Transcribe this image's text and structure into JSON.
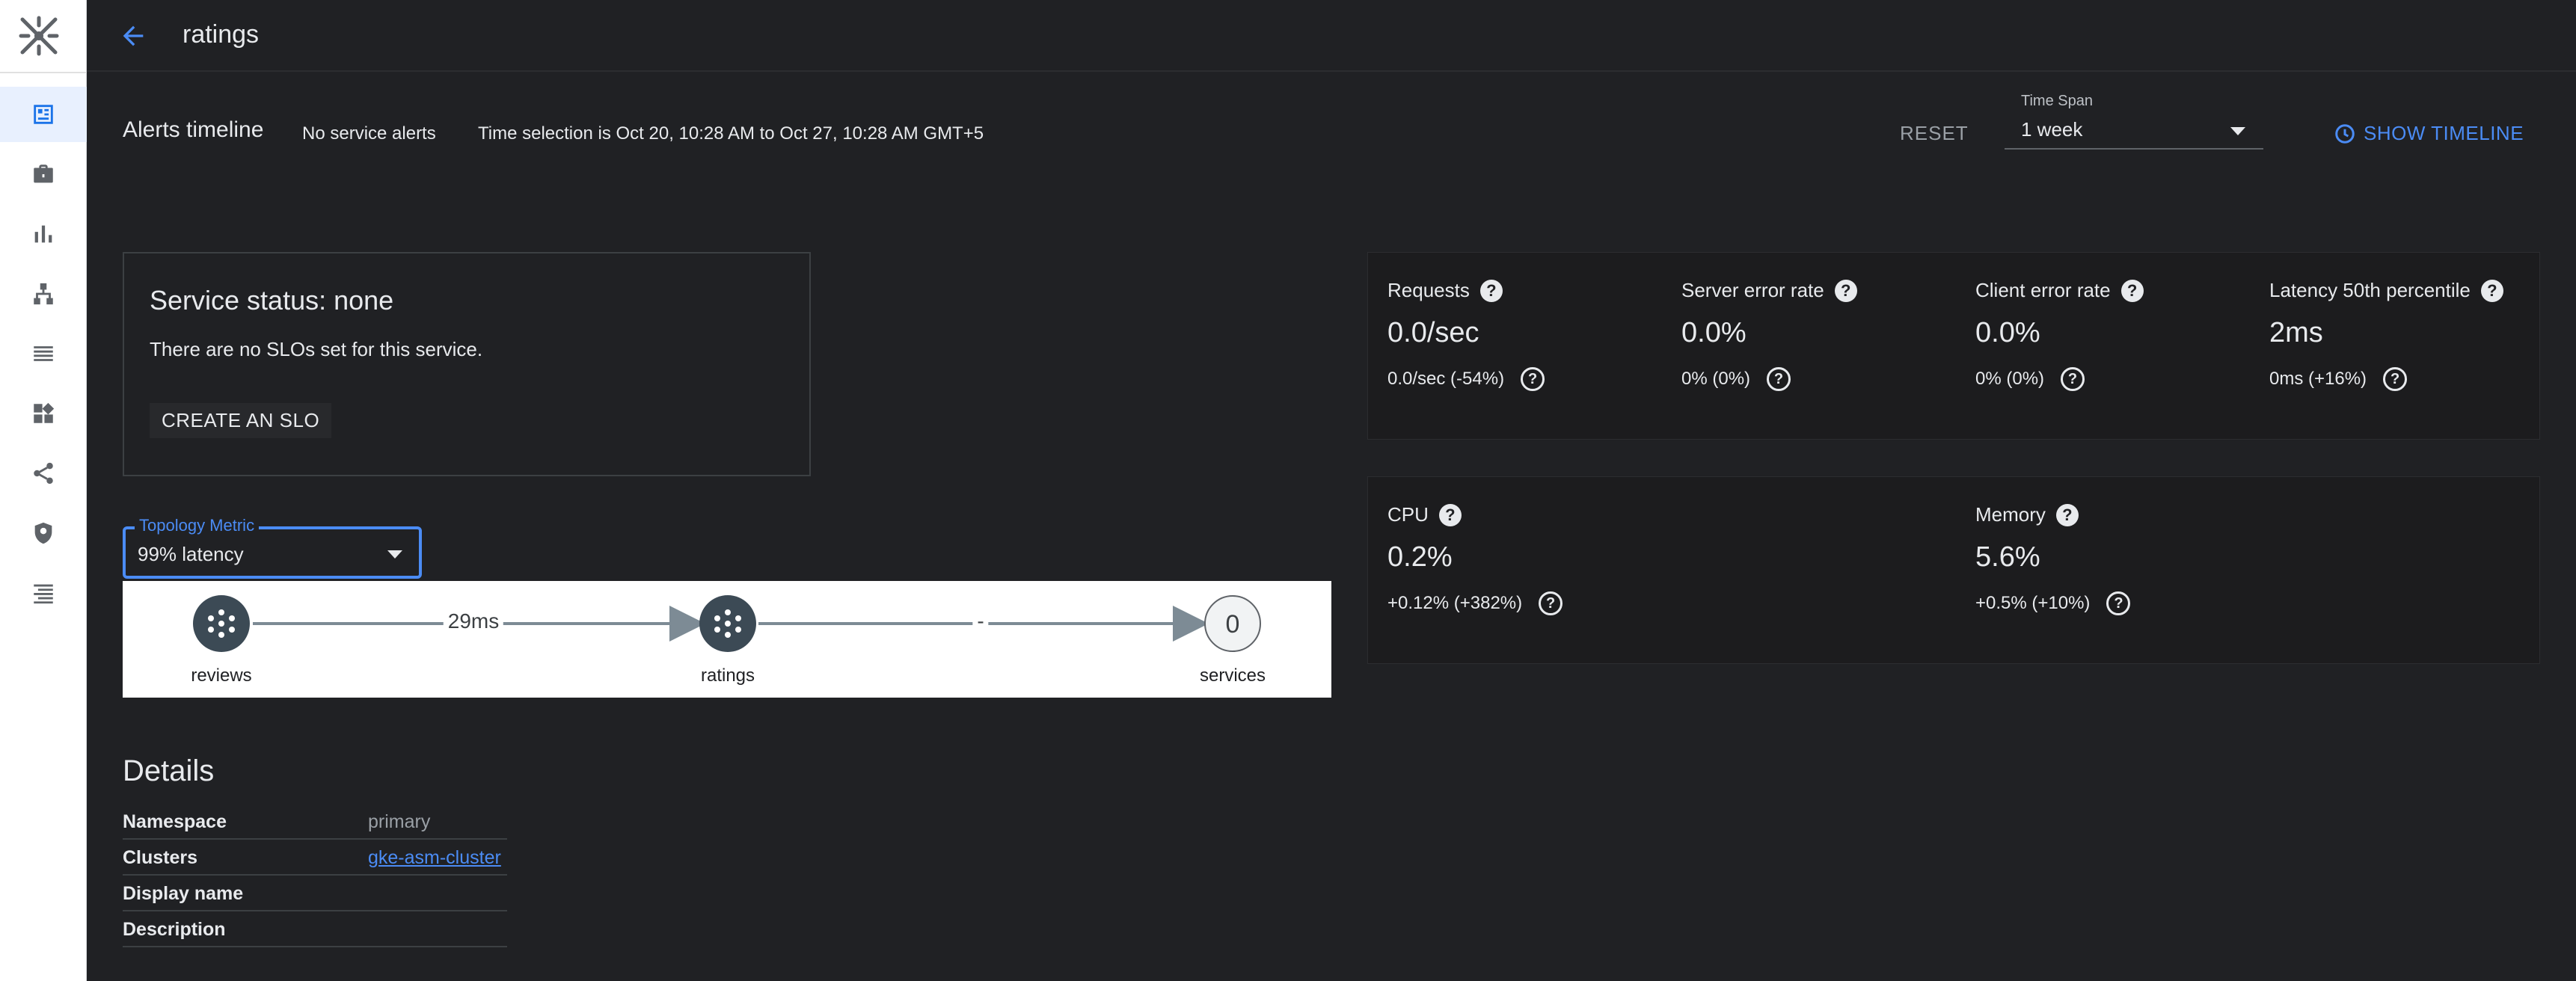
{
  "header": {
    "title": "ratings"
  },
  "nav": {
    "items": [
      {
        "icon": "dashboard-icon",
        "active": true
      },
      {
        "icon": "briefcase-icon",
        "active": false
      },
      {
        "icon": "bar-chart-icon",
        "active": false
      },
      {
        "icon": "topology-icon",
        "active": false
      },
      {
        "icon": "list-icon",
        "active": false
      },
      {
        "icon": "widgets-icon",
        "active": false
      },
      {
        "icon": "share-icon",
        "active": false
      },
      {
        "icon": "security-shield-icon",
        "active": false
      },
      {
        "icon": "menu-list-icon",
        "active": false
      }
    ]
  },
  "alerts": {
    "title": "Alerts timeline",
    "status": "No service alerts",
    "time_selection": "Time selection is Oct 20, 10:28 AM to Oct 27, 10:28 AM GMT+5",
    "reset_label": "RESET",
    "time_span_label": "Time Span",
    "time_span_value": "1 week",
    "show_timeline_label": "SHOW TIMELINE"
  },
  "service_status": {
    "title": "Service status: none",
    "description": "There are no SLOs set for this service.",
    "create_button": "CREATE AN SLO"
  },
  "topology": {
    "metric_label": "Topology Metric",
    "metric_value": "99% latency",
    "nodes": [
      {
        "label": "reviews",
        "type": "service"
      },
      {
        "label": "ratings",
        "type": "service"
      },
      {
        "label": "services",
        "type": "count",
        "count": "0"
      }
    ],
    "edges": [
      {
        "label": "29ms"
      },
      {
        "label": "-"
      }
    ]
  },
  "details": {
    "title": "Details",
    "rows": [
      {
        "key": "Namespace",
        "value": "primary",
        "link": false
      },
      {
        "key": "Clusters",
        "value": "gke-asm-cluster",
        "link": true
      },
      {
        "key": "Display name",
        "value": "",
        "link": false
      },
      {
        "key": "Description",
        "value": "",
        "link": false
      }
    ]
  },
  "metrics": {
    "requests": {
      "name": "Requests",
      "value": "0.0/sec",
      "delta": "0.0/sec (-54%)"
    },
    "server_error_rate": {
      "name": "Server error rate",
      "value": "0.0%",
      "delta": "0% (0%)"
    },
    "client_error_rate": {
      "name": "Client error rate",
      "value": "0.0%",
      "delta": "0% (0%)"
    },
    "latency_p50": {
      "name": "Latency 50th percentile",
      "value": "2ms",
      "delta": "0ms (+16%)"
    },
    "cpu": {
      "name": "CPU",
      "value": "0.2%",
      "delta": "+0.12% (+382%)"
    },
    "memory": {
      "name": "Memory",
      "value": "5.6%",
      "delta": "+0.5% (+10%)"
    }
  },
  "colors": {
    "background": "#202124",
    "accent": "#4b8cf5",
    "nav_active": "#e8f0fe",
    "node_fill": "#3c4a55"
  }
}
